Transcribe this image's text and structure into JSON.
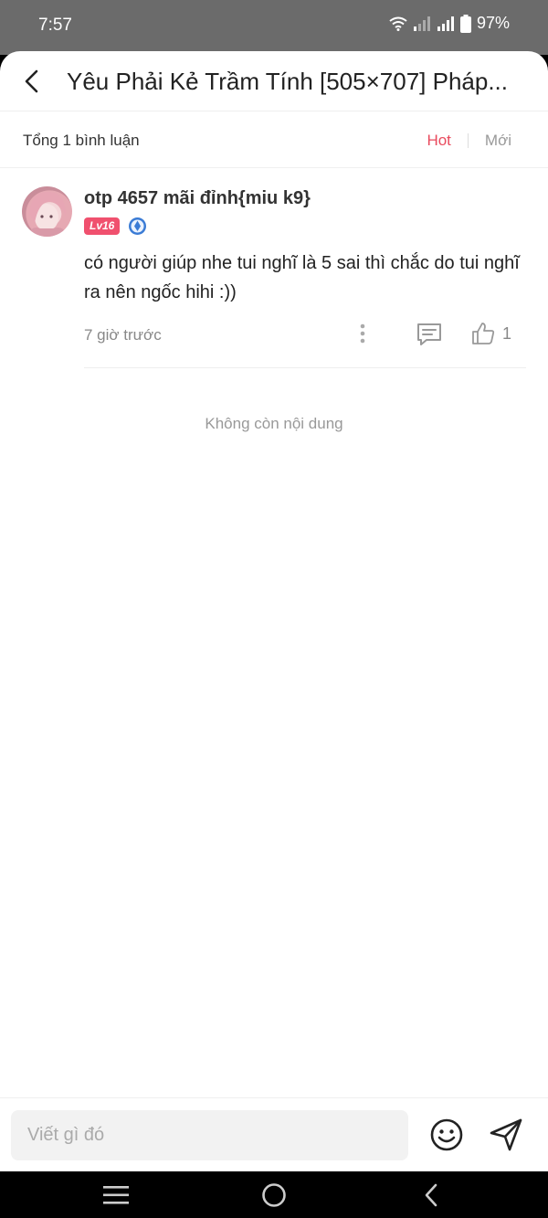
{
  "status_bar": {
    "time": "7:57",
    "battery": "97%"
  },
  "header": {
    "title": "Yêu Phải Kẻ Trầm Tính [505×707] Pháp..."
  },
  "comments_header": {
    "count_label": "Tổng 1 bình luận",
    "sort_options": [
      "Hot",
      "Mới"
    ],
    "active_sort": "Hot"
  },
  "comments": [
    {
      "username": "otp 4657 mãi đỉnh{miu k9}",
      "level": "Lv16",
      "content": "có người giúp nhe tui nghĩ là 5 sai thì chắc do tui nghĩ ra nên ngốc hihi :))",
      "time": "7 giờ trước",
      "likes": "1"
    }
  ],
  "end_message": "Không còn nội dung",
  "input": {
    "placeholder": "Viết gì đó"
  },
  "colors": {
    "accent": "#e94a5d",
    "level_badge": "#f0506e",
    "verified": "#3a7bd5"
  }
}
